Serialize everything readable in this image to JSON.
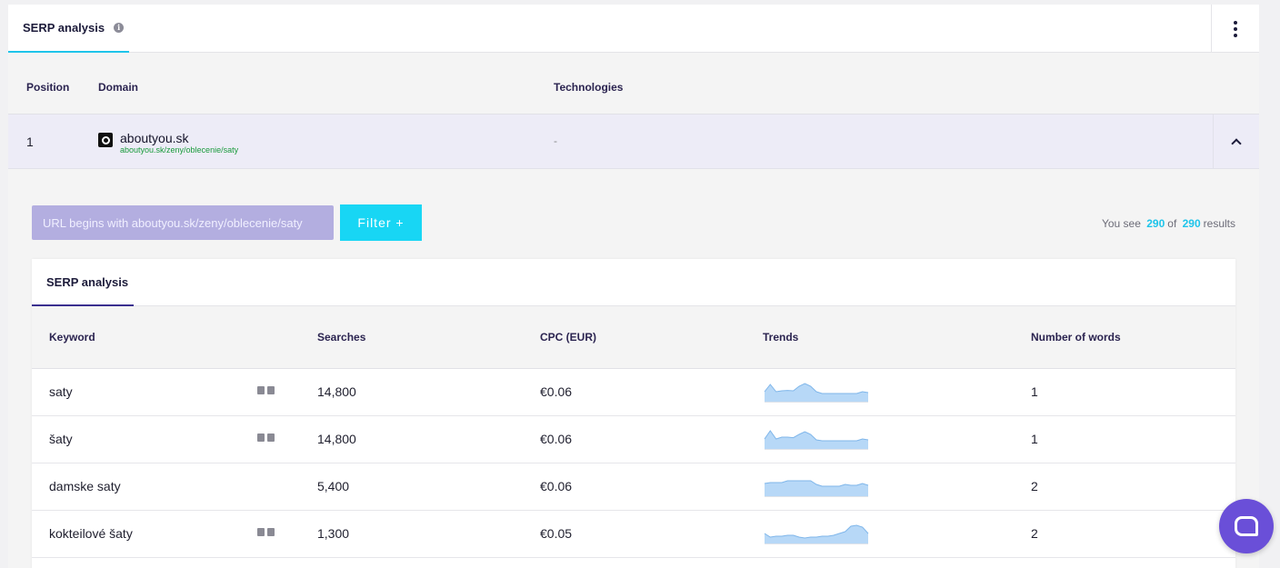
{
  "header": {
    "tab_label": "SERP analysis"
  },
  "columns_top": {
    "position": "Position",
    "domain": "Domain",
    "technologies": "Technologies"
  },
  "row": {
    "position": "1",
    "domain": "aboutyou.sk",
    "url": "aboutyou.sk/zeny/oblecenie/saty",
    "technologies": "-"
  },
  "filter": {
    "chip_label": "URL begins with aboutyou.sk/zeny/oblecenie/saty",
    "button_label": "Filter +"
  },
  "results": {
    "prefix": "You see",
    "shown": "290",
    "of": "of",
    "total": "290",
    "suffix": "results"
  },
  "inner": {
    "tab_label": "SERP analysis"
  },
  "columns": {
    "keyword": "Keyword",
    "searches": "Searches",
    "cpc": "CPC (EUR)",
    "trends": "Trends",
    "words": "Number of words"
  },
  "keywords": [
    {
      "keyword": "saty",
      "searches": "14,800",
      "cpc": "€0.06",
      "words": "1",
      "serp_icons": [
        "map-icon",
        "shopping-icon"
      ],
      "trend": [
        0.55,
        0.95,
        0.55,
        0.6,
        0.62,
        0.6,
        0.85,
        1.0,
        0.85,
        0.55,
        0.45,
        0.45,
        0.45,
        0.45,
        0.45,
        0.45,
        0.45,
        0.55,
        0.5
      ]
    },
    {
      "keyword": "šaty",
      "searches": "14,800",
      "cpc": "€0.06",
      "words": "1",
      "serp_icons": [
        "map-icon",
        "image-icon"
      ],
      "trend": [
        0.55,
        1.0,
        0.55,
        0.65,
        0.65,
        0.62,
        0.8,
        0.95,
        0.8,
        0.5,
        0.45,
        0.45,
        0.45,
        0.45,
        0.45,
        0.45,
        0.45,
        0.55,
        0.5
      ]
    },
    {
      "keyword": "damske saty",
      "searches": "5,400",
      "cpc": "€0.06",
      "words": "2",
      "serp_icons": [],
      "trend": [
        0.7,
        0.75,
        0.75,
        0.75,
        0.85,
        0.85,
        0.85,
        0.85,
        0.85,
        0.65,
        0.55,
        0.55,
        0.55,
        0.55,
        0.65,
        0.6,
        0.6,
        0.7,
        0.6
      ]
    },
    {
      "keyword": "kokteilové šaty",
      "searches": "1,300",
      "cpc": "€0.05",
      "words": "2",
      "serp_icons": [
        "map-icon",
        "image-icon"
      ],
      "trend": [
        0.55,
        0.35,
        0.4,
        0.4,
        0.45,
        0.45,
        0.35,
        0.3,
        0.35,
        0.35,
        0.4,
        0.4,
        0.45,
        0.55,
        0.65,
        0.95,
        1.0,
        0.9,
        0.55
      ]
    }
  ],
  "colors": {
    "accent": "#1ec4ea",
    "purple": "#3a2f8f",
    "chip": "#b3aee0",
    "trend_fill": "#b7d8f7",
    "trend_line": "#7fb6ea",
    "chat": "#6a4fd8"
  }
}
